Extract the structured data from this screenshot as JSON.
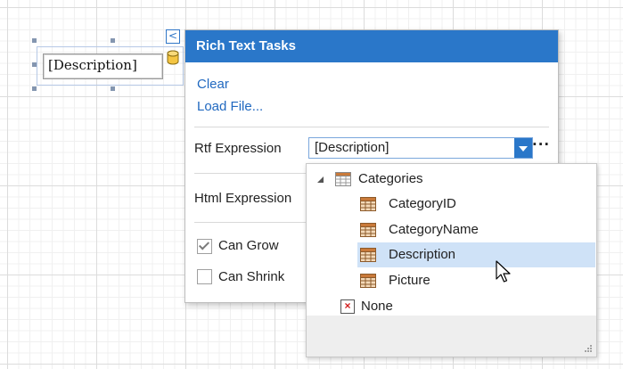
{
  "report_control": {
    "text": "[Description]"
  },
  "smart_tag": {
    "glyph": "<"
  },
  "panel": {
    "title": "Rich Text Tasks",
    "links": {
      "clear": "Clear",
      "load_file": "Load File..."
    },
    "rtf_expression": {
      "label": "Rtf Expression",
      "value": "[Description]",
      "more": "···"
    },
    "html_expression": {
      "label": "Html Expression"
    },
    "can_grow": {
      "label": "Can Grow",
      "checked": true
    },
    "can_shrink": {
      "label": "Can Shrink",
      "checked": false
    }
  },
  "dropdown": {
    "root": {
      "label": "Categories",
      "expanded": true,
      "icon": "table-icon"
    },
    "fields": [
      {
        "label": "CategoryID",
        "icon": "field-icon"
      },
      {
        "label": "CategoryName",
        "icon": "field-icon"
      },
      {
        "label": "Description",
        "icon": "field-icon",
        "selected": true
      },
      {
        "label": "Picture",
        "icon": "field-icon"
      }
    ],
    "none": {
      "label": "None",
      "icon": "none-icon"
    }
  },
  "colors": {
    "accent": "#2a77c9",
    "link": "#2169c0",
    "selection": "#cfe2f7"
  }
}
